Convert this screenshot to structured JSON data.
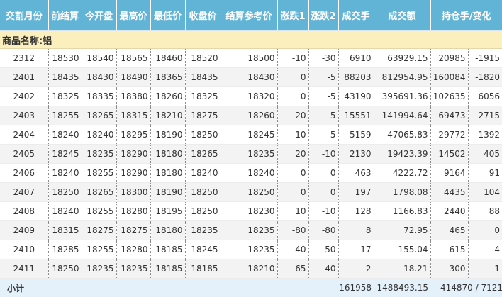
{
  "headers": [
    "交割月份",
    "前结算",
    "今开盘",
    "最高价",
    "最低价",
    "收盘价",
    "结算参考价",
    "涨跌1",
    "涨跌2",
    "成交手",
    "成交额",
    "持仓手/变化"
  ],
  "category_label": "商品名称:铝",
  "rows": [
    [
      "2312",
      "18530",
      "18540",
      "18565",
      "18460",
      "18520",
      "18500",
      "-10",
      "-30",
      "6910",
      "63929.15",
      "20985",
      "-1915"
    ],
    [
      "2401",
      "18435",
      "18430",
      "18490",
      "18365",
      "18435",
      "18430",
      "0",
      "-5",
      "88203",
      "812954.95",
      "160084",
      "-1820"
    ],
    [
      "2402",
      "18325",
      "18335",
      "18380",
      "18260",
      "18325",
      "18320",
      "0",
      "-5",
      "43190",
      "395691.36",
      "102635",
      "6056"
    ],
    [
      "2403",
      "18255",
      "18265",
      "18315",
      "18210",
      "18275",
      "18260",
      "20",
      "5",
      "15551",
      "141994.64",
      "69473",
      "2715"
    ],
    [
      "2404",
      "18240",
      "18240",
      "18295",
      "18190",
      "18250",
      "18245",
      "10",
      "5",
      "5159",
      "47065.83",
      "29772",
      "1392"
    ],
    [
      "2405",
      "18245",
      "18235",
      "18290",
      "18180",
      "18265",
      "18235",
      "20",
      "-10",
      "2130",
      "19423.39",
      "14502",
      "405"
    ],
    [
      "2406",
      "18240",
      "18255",
      "18290",
      "18180",
      "18240",
      "18240",
      "0",
      "0",
      "463",
      "4222.72",
      "9164",
      "91"
    ],
    [
      "2407",
      "18250",
      "18265",
      "18300",
      "18190",
      "18250",
      "18250",
      "0",
      "0",
      "197",
      "1798.08",
      "4435",
      "104"
    ],
    [
      "2408",
      "18240",
      "18255",
      "18280",
      "18195",
      "18250",
      "18230",
      "10",
      "-10",
      "128",
      "1166.83",
      "2440",
      "88"
    ],
    [
      "2409",
      "18315",
      "18275",
      "18275",
      "18180",
      "18235",
      "18235",
      "-80",
      "-80",
      "8",
      "72.95",
      "465",
      "0"
    ],
    [
      "2410",
      "18285",
      "18255",
      "18280",
      "18185",
      "18245",
      "18235",
      "-40",
      "-50",
      "17",
      "155.04",
      "615",
      "4"
    ],
    [
      "2411",
      "18250",
      "18235",
      "18235",
      "18185",
      "18185",
      "18210",
      "-65",
      "-40",
      "2",
      "18.21",
      "300",
      "1"
    ]
  ],
  "subtotal": {
    "label": "小计",
    "volume": "161958",
    "turnover": "1488493.15",
    "open_interest": "414870 / 7121"
  }
}
